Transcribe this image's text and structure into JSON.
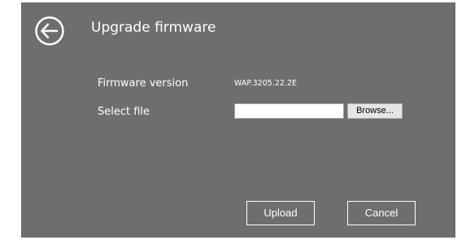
{
  "header": {
    "back_icon": "arrow-left-circle-icon",
    "title": "Upgrade firmware"
  },
  "form": {
    "firmware_version_label": "Firmware version",
    "firmware_version_value": "WAP.3205.22.2E",
    "select_file_label": "Select file",
    "file_value": "",
    "browse_label": "Browse..."
  },
  "actions": {
    "upload_label": "Upload",
    "cancel_label": "Cancel"
  },
  "colors": {
    "panel_background": "#6e6e6e",
    "text": "#ffffff",
    "browse_background": "#e5e5e5"
  }
}
